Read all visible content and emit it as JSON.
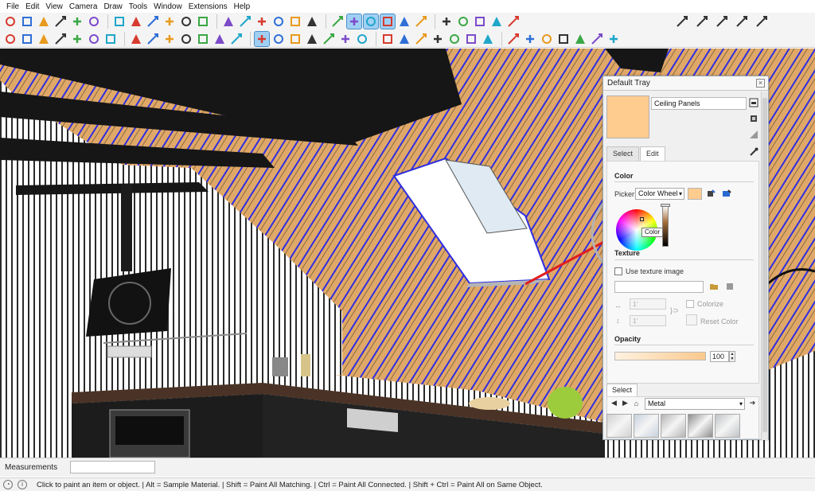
{
  "menu": [
    "File",
    "Edit",
    "View",
    "Camera",
    "Draw",
    "Tools",
    "Window",
    "Extensions",
    "Help"
  ],
  "toolbar_row1": [
    "select-icon",
    "eraser-icon",
    "paint-icon",
    "arc-icon",
    "text-icon",
    "walk-icon",
    "orbit-icon",
    "pan-icon",
    "zoom-icon",
    "zoom-extents-icon",
    "look-around-icon",
    "position-camera-icon",
    "iso-view-icon",
    "top-view-icon",
    "front-view-icon",
    "right-view-icon",
    "back-view-icon",
    "left-view-icon",
    "xray-icon",
    "back-edges-icon",
    "wireframe-icon",
    "hidden-line-icon",
    "shaded-icon",
    "shaded-textures-icon",
    "monochrome-icon",
    "section-plane-icon",
    "components-icon",
    "warehouse-icon",
    "extension-warehouse-icon"
  ],
  "toolbar_row1_right": [
    "reload-icon",
    "sync-icon",
    "plug-icon",
    "export-icon",
    "document-icon"
  ],
  "toolbar_row2": [
    "zoom-icon",
    "select-icon",
    "eraser-icon",
    "pencil-icon",
    "line-icon",
    "rectangle-icon",
    "push-pull-icon",
    "move-icon",
    "rotate-icon",
    "scale-icon",
    "offset-icon",
    "tape-measure-icon",
    "protractor-icon",
    "paint-bucket-icon",
    "paint-active-icon",
    "orbit-icon",
    "pan-icon",
    "zoom-window-icon",
    "zoom-extents-icon",
    "solid-union-icon",
    "sandbox-icon",
    "layers-icon",
    "styles-icon",
    "page-icon",
    "scenes-icon",
    "follow-me-icon",
    "intersect-icon",
    "match-photo-icon",
    "soften-icon",
    "dimension-icon",
    "section-icon",
    "model-info-icon",
    "ruby-console-icon",
    "axes-icon",
    "guides-icon"
  ],
  "tray": {
    "title": "Default Tray",
    "material_name": "Ceiling Panels",
    "swatch_color": "#ffcc8f",
    "tabs": [
      "Select",
      "Edit"
    ],
    "active_tab": "Edit",
    "color_section": "Color",
    "picker_label": "Picker:",
    "picker_value": "Color Wheel",
    "tooltip": "Color",
    "texture_section": "Texture",
    "use_texture_label": "Use texture image",
    "width_value": "1'",
    "height_value": "1'",
    "colorize_label": "Colorize",
    "reset_color_label": "Reset Color",
    "opacity_section": "Opacity",
    "opacity_value": "100",
    "opacity_level": 1.0,
    "select_tab": "Select",
    "library_value": "Metal",
    "thumbs": [
      "#d0d0d2",
      "#c6d0dc",
      "#b3b3b3",
      "#8e8e8e",
      "#bfc3c6"
    ]
  },
  "measurements_label": "Measurements",
  "measurements_value": "",
  "status_text": "Click to paint an item or object. | Alt = Sample Material. | Shift = Paint All Matching. | Ctrl = Paint All Connected. | Shift + Ctrl = Paint All on Same Object.",
  "colors": {
    "ceiling": "#e0a868",
    "stripes": "#2e2ee0",
    "beams": "#161616",
    "arrow": "#e02020",
    "cabinets": "#1c1c1c",
    "countertop": "#4a3326"
  }
}
